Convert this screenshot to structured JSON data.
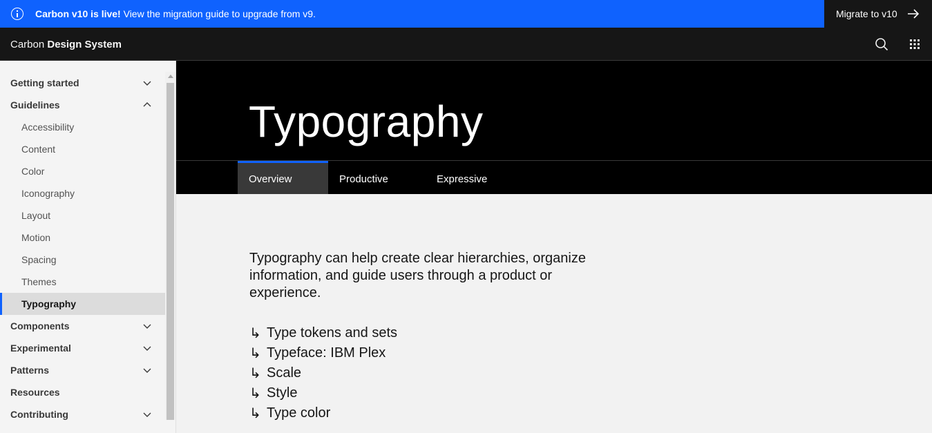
{
  "banner": {
    "strong": "Carbon v10 is live!",
    "text": " View the migration guide to upgrade from v9.",
    "cta": "Migrate to v10",
    "color": "#0f62fe"
  },
  "header": {
    "logo_light": "Carbon ",
    "logo_strong": "Design System",
    "icons": [
      "search-icon",
      "app-switcher-icon"
    ]
  },
  "sidebar": {
    "items": [
      {
        "label": "Getting started",
        "chevron": "down"
      },
      {
        "label": "Guidelines",
        "chevron": "up"
      },
      {
        "label": "Components",
        "chevron": "down"
      },
      {
        "label": "Experimental",
        "chevron": "down"
      },
      {
        "label": "Patterns",
        "chevron": "down"
      },
      {
        "label": "Resources"
      },
      {
        "label": "Contributing",
        "chevron": "down"
      }
    ],
    "guidelines_children": [
      "Accessibility",
      "Content",
      "Color",
      "Iconography",
      "Layout",
      "Motion",
      "Spacing",
      "Themes",
      "Typography"
    ],
    "active": "Typography"
  },
  "page": {
    "title": "Typography",
    "tabs": [
      "Overview",
      "Productive",
      "Expressive"
    ],
    "selected_tab": "Overview",
    "lead": "Typography can help create clear hierarchies, organize information, and guide users through a product or experience.",
    "anchor_arrow": "↳",
    "anchors": [
      "Type tokens and sets",
      "Typeface: IBM Plex",
      "Scale",
      "Style",
      "Type color"
    ]
  }
}
